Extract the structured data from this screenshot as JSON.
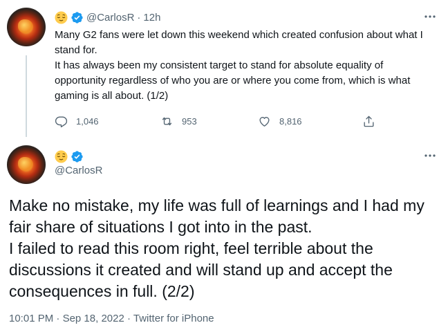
{
  "tweet1": {
    "emoji": "relieved-face-emoji",
    "verified_icon": "verified-badge-icon",
    "handle": "@CarlosR",
    "separator": "·",
    "time": "12h",
    "text_lines": [
      "Many G2 fans were let down this weekend which created confusion about what I stand for.",
      "It has always been my consistent target to stand for absolute equality of opportunity regardless of who you are or where you come from, which is what gaming is all about. (1/2)"
    ],
    "actions": {
      "reply_count": "1,046",
      "retweet_count": "953",
      "like_count": "8,816"
    }
  },
  "tweet2": {
    "emoji": "relieved-face-emoji",
    "verified_icon": "verified-badge-icon",
    "handle": "@CarlosR",
    "text_lines": [
      "Make no mistake, my life was full of learnings and I had my fair share of situations I got into in the past.",
      "I failed to read this room right, feel terrible about the discussions it created and will stand up and accept the consequences in full. (2/2)"
    ],
    "meta": {
      "time": "10:01 PM",
      "sep1": "·",
      "date": "Sep 18, 2022",
      "sep2": "·",
      "source": "Twitter for iPhone"
    }
  },
  "colors": {
    "text": "#0f1419",
    "secondary": "#536471",
    "verified": "#1d9bf0",
    "thread_line": "#cfd9de"
  }
}
